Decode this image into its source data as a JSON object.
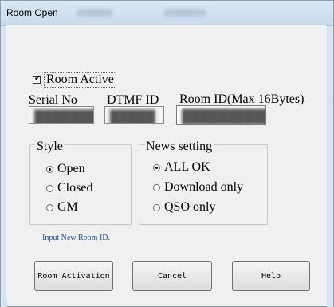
{
  "window": {
    "title": "Room Open"
  },
  "room_active": {
    "label": "Room Active",
    "checked": true,
    "check_glyph": "✔"
  },
  "fields": {
    "serial_label": "Serial No",
    "serial_value": "████████",
    "dtmf_label": "DTMF ID",
    "dtmf_value": "█████",
    "roomid_label": "Room ID(Max 16Bytes)",
    "roomid_value": "███████████"
  },
  "style_group": {
    "title": "Style",
    "options": [
      "Open",
      "Closed",
      "GM"
    ],
    "selected": "Open"
  },
  "news_group": {
    "title": "News setting",
    "options": [
      "ALL OK",
      "Download only",
      "QSO only"
    ],
    "selected": "ALL OK"
  },
  "message": "Input New Room ID.",
  "buttons": {
    "activation": "Room Activation",
    "cancel": "Cancel",
    "help": "Help"
  },
  "colors": {
    "message_text": "#2050b0"
  }
}
